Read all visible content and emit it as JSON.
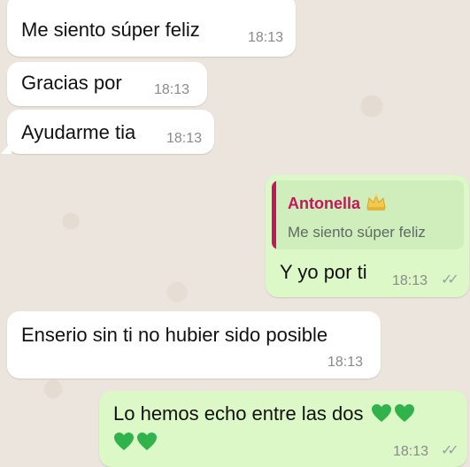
{
  "messages": [
    {
      "direction": "incoming",
      "text": "Me siento súper feliz",
      "time": "18:13"
    },
    {
      "direction": "incoming",
      "text": "Gracias por",
      "time": "18:13"
    },
    {
      "direction": "incoming",
      "text": "Ayudarme tia",
      "time": "18:13"
    },
    {
      "direction": "outgoing",
      "reply_to": {
        "author": "Antonella",
        "author_emoji": "crown-emoji",
        "text": "Me siento súper feliz"
      },
      "text": "Y yo por ti",
      "time": "18:13",
      "status": "read"
    },
    {
      "direction": "incoming",
      "text": "Enserio sin ti no hubier sido posible",
      "time": "18:13"
    },
    {
      "direction": "outgoing",
      "text": "Lo hemos echo entre las dos",
      "emoji": "green-heart-emoji",
      "time": "18:13",
      "status": "read"
    }
  ],
  "colors": {
    "incoming_bubble": "#ffffff",
    "outgoing_bubble": "#dcf8c6",
    "quote_accent": "#c2185b",
    "heart": "#2fb34a",
    "background": "#ece5dd"
  }
}
